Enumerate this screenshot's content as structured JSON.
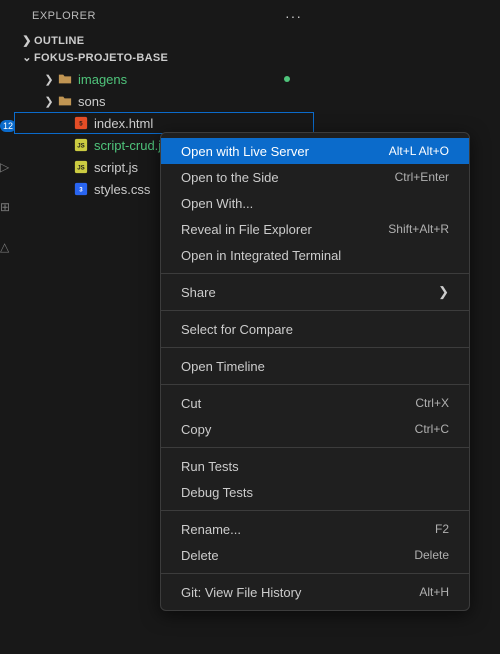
{
  "activity": {
    "badge": "12"
  },
  "sidebar": {
    "title": "EXPLORER",
    "sections": {
      "outline": "OUTLINE",
      "project": "FOKUS-PROJETO-BASE"
    }
  },
  "tree": {
    "imagens": "imagens",
    "sons": "sons",
    "index": "index.html",
    "scriptcrud": "script-crud.js",
    "scriptjs": "script.js",
    "styles": "styles.css"
  },
  "menu": {
    "liveServer": {
      "label": "Open with Live Server",
      "kbd": "Alt+L Alt+O"
    },
    "openSide": {
      "label": "Open to the Side",
      "kbd": "Ctrl+Enter"
    },
    "openWith": {
      "label": "Open With..."
    },
    "reveal": {
      "label": "Reveal in File Explorer",
      "kbd": "Shift+Alt+R"
    },
    "terminal": {
      "label": "Open in Integrated Terminal"
    },
    "share": {
      "label": "Share"
    },
    "compare": {
      "label": "Select for Compare"
    },
    "timeline": {
      "label": "Open Timeline"
    },
    "cut": {
      "label": "Cut",
      "kbd": "Ctrl+X"
    },
    "copy": {
      "label": "Copy",
      "kbd": "Ctrl+C"
    },
    "runTests": {
      "label": "Run Tests"
    },
    "debugTests": {
      "label": "Debug Tests"
    },
    "rename": {
      "label": "Rename...",
      "kbd": "F2"
    },
    "delete": {
      "label": "Delete",
      "kbd": "Delete"
    },
    "gitHistory": {
      "label": "Git: View File History",
      "kbd": "Alt+H"
    }
  }
}
